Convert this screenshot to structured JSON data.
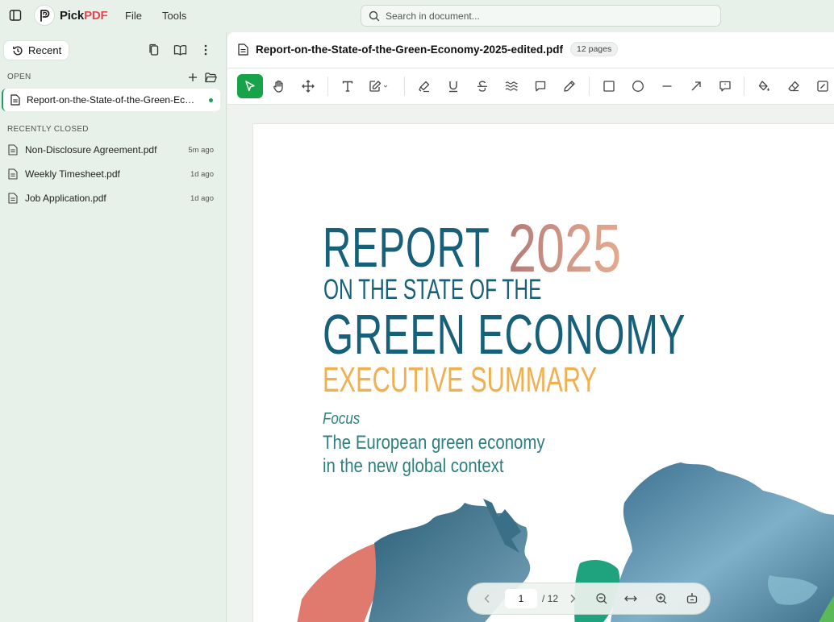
{
  "app": {
    "logo_part1": "Pick",
    "logo_part2": "PDF",
    "menu": [
      "File",
      "Tools"
    ],
    "search_placeholder": "Search in document..."
  },
  "sidebar": {
    "recent_label": "Recent",
    "open_section": "OPEN",
    "open_files": [
      {
        "name": "Report-on-the-State-of-the-Green-Economy-2025-edited.pdf"
      }
    ],
    "recently_closed_section": "RECENTLY CLOSED",
    "recently_closed": [
      {
        "name": "Non-Disclosure Agreement.pdf",
        "time": "5m ago"
      },
      {
        "name": "Weekly Timesheet.pdf",
        "time": "1d ago"
      },
      {
        "name": "Job Application.pdf",
        "time": "1d ago"
      }
    ]
  },
  "document": {
    "title": "Report-on-the-State-of-the-Green-Economy-2025-edited.pdf",
    "pages_badge": "12 pages",
    "cover": {
      "report": "REPORT",
      "year": "2025",
      "on_the_state": "ON THE STATE OF THE",
      "green_economy": "GREEN ECONOMY",
      "executive_summary": "EXECUTIVE SUMMARY",
      "focus": "Focus",
      "subtitle_line1": "The European green economy",
      "subtitle_line2": "in the new global context"
    }
  },
  "toolbar": {
    "tools": [
      "select-icon",
      "hand-icon",
      "move-icon",
      "text-icon",
      "edit-text-icon",
      "highlight-icon",
      "underline-icon",
      "strikethrough-icon",
      "squiggly-icon",
      "comment-icon",
      "pencil-icon",
      "rectangle-icon",
      "ellipse-icon",
      "line-icon",
      "arrow-icon",
      "callout-icon",
      "fill-icon",
      "eraser-icon",
      "edit-box-icon"
    ],
    "active_tool": "select-icon",
    "accent_color": "#17a34a"
  },
  "pager": {
    "current_page": "1",
    "total": "/ 12"
  }
}
